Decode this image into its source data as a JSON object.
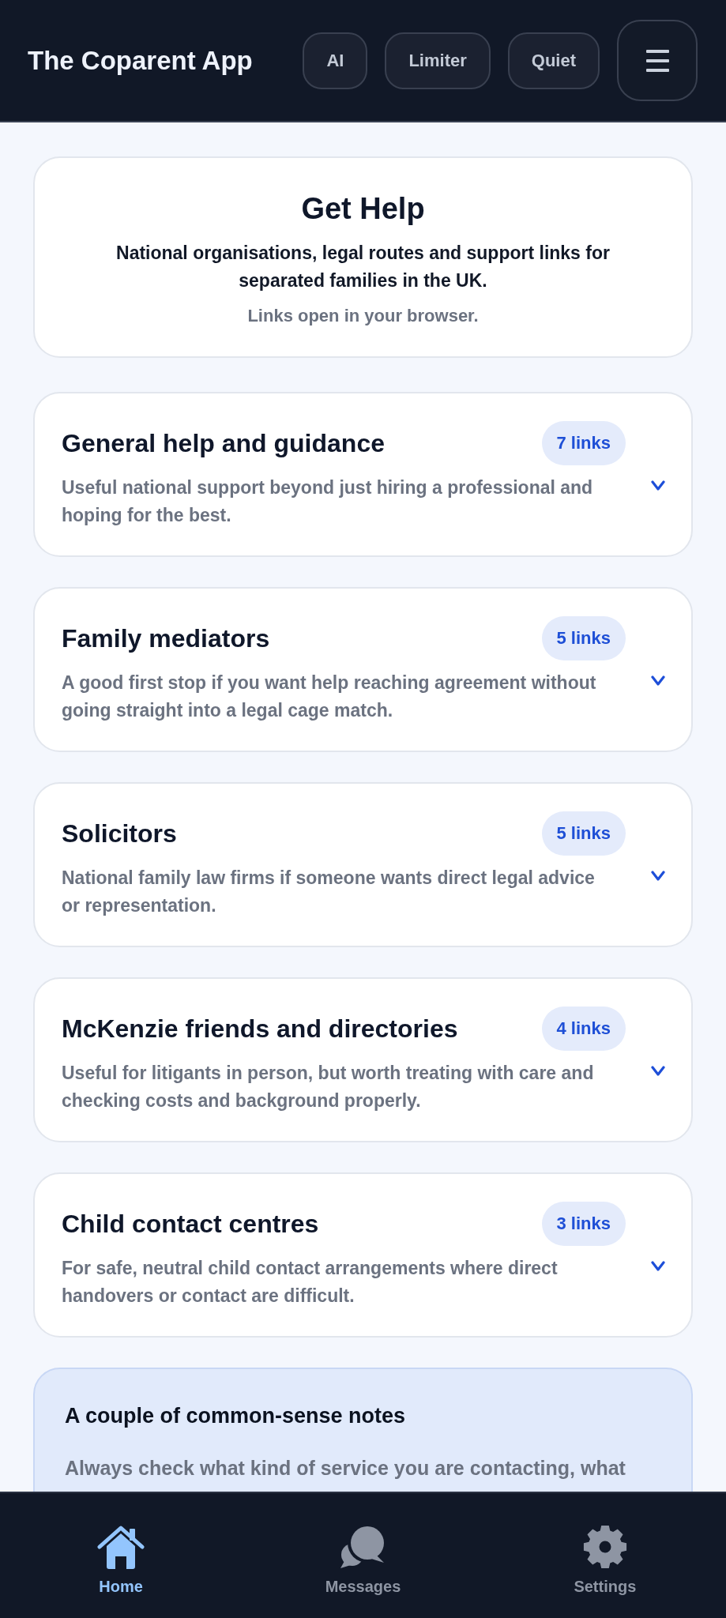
{
  "header": {
    "title": "The Coparent App",
    "buttons": [
      {
        "label": "AI"
      },
      {
        "label": "Limiter"
      },
      {
        "label": "Quiet"
      }
    ]
  },
  "intro": {
    "title": "Get Help",
    "subtitle": "National organisations, legal routes and support links for separated families in the UK.",
    "note": "Links open in your browser."
  },
  "sections": [
    {
      "title": "General help and guidance",
      "count": "7 links",
      "description": "Useful national support beyond just hiring a professional and hoping for the best.",
      "expanded": false
    },
    {
      "title": "Family mediators",
      "count": "5 links",
      "description": "A good first stop if you want help reaching agreement without going straight into a legal cage match.",
      "expanded": false
    },
    {
      "title": "Solicitors",
      "count": "5 links",
      "description": "National family law firms if someone wants direct legal advice or representation.",
      "expanded": false
    },
    {
      "title": "McKenzie friends and directories",
      "count": "4 links",
      "description": "Useful for litigants in person, but worth treating with care and checking costs and background properly.",
      "expanded": false
    },
    {
      "title": "Child contact centres",
      "count": "3 links",
      "description": "For safe, neutral child contact arrangements where direct handovers or contact are difficult.",
      "expanded": false
    }
  ],
  "notes": {
    "title": "A couple of common-sense notes",
    "text": "Always check what kind of service you are contacting, what"
  },
  "bottom_nav": [
    {
      "kind": "home",
      "label": "Home",
      "selected": true
    },
    {
      "kind": "messages",
      "label": "Messages",
      "selected": false
    },
    {
      "kind": "settings",
      "label": "Settings",
      "selected": false
    }
  ]
}
